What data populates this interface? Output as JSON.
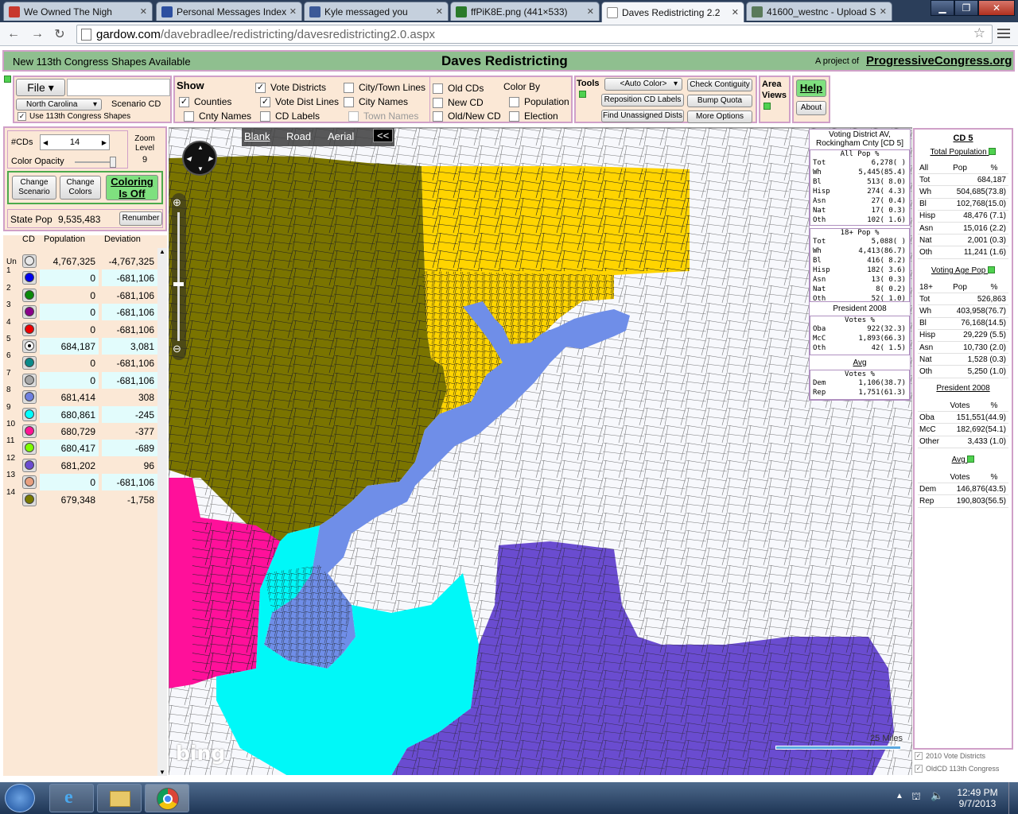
{
  "browser": {
    "tabs": [
      {
        "label": "We Owned The Nigh",
        "active": false,
        "icon_color": "#c8382d"
      },
      {
        "label": "Personal Messages Index",
        "active": false,
        "icon_color": "#2d4fa0"
      },
      {
        "label": "Kyle messaged you",
        "active": false,
        "icon_color": "#3b5998"
      },
      {
        "label": "ffPiK8E.png (441×533)",
        "active": false,
        "icon_color": "#2a7a2a"
      },
      {
        "label": "Daves Redistricting 2.2",
        "active": true,
        "icon_color": "#ffffff"
      },
      {
        "label": "41600_westnc - Upload S",
        "active": false,
        "icon_color": "#5a7a5a"
      }
    ],
    "url_domain": "gardow.com",
    "url_path": "/davebradlee/redistricting/davesredistricting2.0.aspx"
  },
  "header": {
    "new_shapes": "New 113th Congress Shapes Available",
    "title": "Daves Redistricting",
    "project_prefix": "A project of",
    "project_link": "ProgressiveCongress.org"
  },
  "filepanel": {
    "file_label": "File",
    "state": "North Carolina",
    "scenario_label": "Scenario CD",
    "use_113": "Use 113th Congress Shapes"
  },
  "show": {
    "title": "Show",
    "counties": "Counties",
    "cnty_names": "Cnty Names",
    "vote_districts": "Vote Districts",
    "vote_dist_lines": "Vote Dist Lines",
    "cd_labels": "CD Labels",
    "city_town_lines": "City/Town Lines",
    "city_names": "City Names",
    "town_names": "Town Names",
    "old_cds": "Old CDs",
    "new_cd": "New CD",
    "old_new_cd": "Old/New CD",
    "color_by": "Color By",
    "population": "Population",
    "election": "Election"
  },
  "tools": {
    "title": "Tools",
    "auto_color": "<Auto Color>",
    "check_contiguity": "Check Contiguity",
    "reposition": "Reposition CD Labels",
    "bump_quota": "Bump Quota",
    "find_unassigned": "Find Unassigned Dists",
    "more_options": "More Options",
    "area_views": "Area Views",
    "help": "Help",
    "about": "About"
  },
  "leftpanel": {
    "num_cds_label": "#CDs",
    "num_cds": "14",
    "zoom_label": "Zoom Level",
    "zoom": "9",
    "color_opacity": "Color Opacity",
    "change_scenario": "Change Scenario",
    "change_colors": "Change Colors",
    "coloring": "Coloring Is Off",
    "state_pop_label": "State Pop",
    "state_pop": "9,535,483",
    "renumber": "Renumber"
  },
  "cdtable": {
    "headers": {
      "cd": "CD",
      "population": "Population",
      "deviation": "Deviation"
    },
    "rows": [
      {
        "cd": "Un",
        "color": "#e8e8e8",
        "pop": "4,767,325",
        "dev": "-4,767,325",
        "selected": false
      },
      {
        "cd": "1",
        "color": "#0000ee",
        "pop": "0",
        "dev": "-681,106",
        "selected": false
      },
      {
        "cd": "2",
        "color": "#0a8a0a",
        "pop": "0",
        "dev": "-681,106",
        "selected": false
      },
      {
        "cd": "3",
        "color": "#8a008a",
        "pop": "0",
        "dev": "-681,106",
        "selected": false
      },
      {
        "cd": "4",
        "color": "#ee0000",
        "pop": "0",
        "dev": "-681,106",
        "selected": false
      },
      {
        "cd": "5",
        "color": "#ffd700",
        "pop": "684,187",
        "dev": "3,081",
        "selected": true
      },
      {
        "cd": "6",
        "color": "#0a8a8a",
        "pop": "0",
        "dev": "-681,106",
        "selected": false
      },
      {
        "cd": "7",
        "color": "#a8a8a8",
        "pop": "0",
        "dev": "-681,106",
        "selected": false
      },
      {
        "cd": "8",
        "color": "#6f80e0",
        "pop": "681,414",
        "dev": "308",
        "selected": false
      },
      {
        "cd": "9",
        "color": "#00ffff",
        "pop": "680,861",
        "dev": "-245",
        "selected": false
      },
      {
        "cd": "10",
        "color": "#ff1493",
        "pop": "680,729",
        "dev": "-377",
        "selected": false
      },
      {
        "cd": "11",
        "color": "#7fff00",
        "pop": "680,417",
        "dev": "-689",
        "selected": false
      },
      {
        "cd": "12",
        "color": "#6a4cd0",
        "pop": "681,202",
        "dev": "96",
        "selected": false
      },
      {
        "cd": "13",
        "color": "#e8a080",
        "pop": "0",
        "dev": "-681,106",
        "selected": false
      },
      {
        "cd": "14",
        "color": "#7a7a00",
        "pop": "679,348",
        "dev": "-1,758",
        "selected": false
      }
    ]
  },
  "map": {
    "blank": "Blank",
    "road": "Road",
    "aerial": "Aerial",
    "collapse": "<<",
    "bing": "bing",
    "scale": "25 Miles"
  },
  "popup": {
    "title1": "Voting District AV,",
    "title2": "Rockingham Cnty [CD 5]",
    "allpop_header": "All Pop   %",
    "allpop": [
      [
        "Tot",
        "6,278(    )"
      ],
      [
        "Wh",
        "5,445(85.4)"
      ],
      [
        "Bl",
        "513( 8.0)"
      ],
      [
        "Hisp",
        "274( 4.3)"
      ],
      [
        "Asn",
        "27( 0.4)"
      ],
      [
        "Nat",
        "17( 0.3)"
      ],
      [
        "Oth",
        "102( 1.6)"
      ]
    ],
    "vap_header": "18+ Pop   %",
    "vap": [
      [
        "Tot",
        "5,088(    )"
      ],
      [
        "Wh",
        "4,413(86.7)"
      ],
      [
        "Bl",
        "416( 8.2)"
      ],
      [
        "Hisp",
        "182( 3.6)"
      ],
      [
        "Asn",
        "13( 0.3)"
      ],
      [
        "Nat",
        "8( 0.2)"
      ],
      [
        "Oth",
        "52( 1.0)"
      ]
    ],
    "pres_title": "President 2008",
    "pres_header": "Votes   %",
    "pres": [
      [
        "Oba",
        "922(32.3)"
      ],
      [
        "McC",
        "1,893(66.3)"
      ],
      [
        "Oth",
        "42( 1.5)"
      ]
    ],
    "avg_title": "Avg",
    "avg_header": "Votes   %",
    "avg": [
      [
        "Dem",
        "1,106(38.7)"
      ],
      [
        "Rep",
        "1,751(61.3)"
      ]
    ]
  },
  "rightpanel": {
    "title": "CD 5",
    "total_pop_title": "Total Population",
    "total_header": [
      "All",
      "Pop",
      "%"
    ],
    "total": [
      [
        "Tot",
        "684,187"
      ],
      [
        "Wh",
        "504,685(73.8)"
      ],
      [
        "Bl",
        "102,768(15.0)"
      ],
      [
        "Hisp",
        "48,476 (7.1)"
      ],
      [
        "Asn",
        "15,016 (2.2)"
      ],
      [
        "Nat",
        "2,001 (0.3)"
      ],
      [
        "Oth",
        "11,241 (1.6)"
      ]
    ],
    "vap_title": "Voting Age Pop",
    "vap_header": [
      "18+",
      "Pop",
      "%"
    ],
    "vap": [
      [
        "Tot",
        "526,863"
      ],
      [
        "Wh",
        "403,958(76.7)"
      ],
      [
        "Bl",
        "76,168(14.5)"
      ],
      [
        "Hisp",
        "29,229 (5.5)"
      ],
      [
        "Asn",
        "10,730 (2.0)"
      ],
      [
        "Nat",
        "1,528 (0.3)"
      ],
      [
        "Oth",
        "5,250 (1.0)"
      ]
    ],
    "pres_title": "President 2008",
    "pres_header": [
      "",
      "Votes",
      "%"
    ],
    "pres": [
      [
        "Oba",
        "151,551(44.9)"
      ],
      [
        "McC",
        "182,692(54.1)"
      ],
      [
        "Other",
        "3,433 (1.0)"
      ]
    ],
    "avg_title": "Avg",
    "avg_header": [
      "",
      "Votes",
      "%"
    ],
    "avg": [
      [
        "Dem",
        "146,876(43.5)"
      ],
      [
        "Rep",
        "190,803(56.5)"
      ]
    ],
    "check1": "2010 Vote Districts",
    "check2": "OldCD 113th Congress"
  },
  "taskbar": {
    "time": "12:49 PM",
    "date": "9/7/2013"
  }
}
